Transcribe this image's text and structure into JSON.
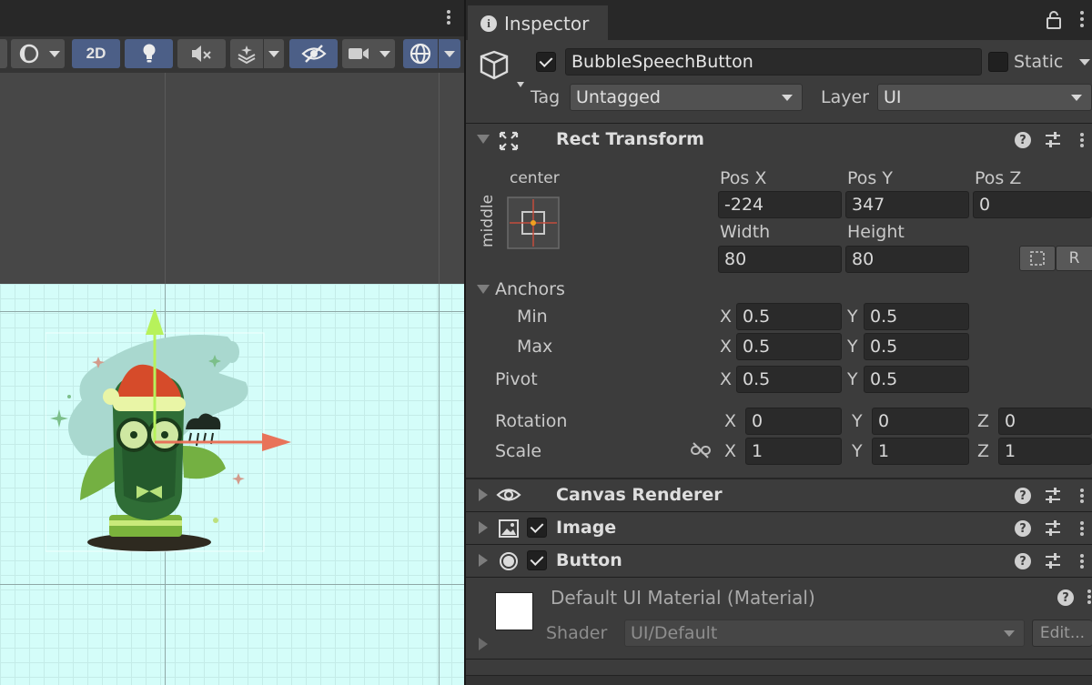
{
  "scene": {
    "toolbar": {
      "mode_2d_label": "2D"
    }
  },
  "inspector": {
    "tab_label": "Inspector",
    "gameobject": {
      "name": "BubbleSpeechButton",
      "active": true,
      "static_label": "Static",
      "tag_label": "Tag",
      "tag_value": "Untagged",
      "layer_label": "Layer",
      "layer_value": "UI"
    },
    "rect_transform": {
      "title": "Rect Transform",
      "anchor_preset_h": "center",
      "anchor_preset_v": "middle",
      "pos_x_label": "Pos X",
      "pos_y_label": "Pos Y",
      "pos_z_label": "Pos Z",
      "pos_x": "-224",
      "pos_y": "347",
      "pos_z": "0",
      "width_label": "Width",
      "height_label": "Height",
      "width": "80",
      "height": "80",
      "raw_edit_label": "R",
      "anchors_label": "Anchors",
      "min_label": "Min",
      "max_label": "Max",
      "pivot_label": "Pivot",
      "anchor_min_x": "0.5",
      "anchor_min_y": "0.5",
      "anchor_max_x": "0.5",
      "anchor_max_y": "0.5",
      "pivot_x": "0.5",
      "pivot_y": "0.5",
      "rotation_label": "Rotation",
      "scale_label": "Scale",
      "rotation_x": "0",
      "rotation_y": "0",
      "rotation_z": "0",
      "scale_x": "1",
      "scale_y": "1",
      "scale_z": "1",
      "axis_x": "X",
      "axis_y": "Y",
      "axis_z": "Z"
    },
    "components": {
      "canvas_renderer": "Canvas Renderer",
      "image": "Image",
      "image_enabled": true,
      "button": "Button",
      "button_enabled": true
    },
    "material": {
      "name": "Default UI Material (Material)",
      "shader_label": "Shader",
      "shader_value": "UI/Default",
      "edit_label": "Edit..."
    }
  },
  "colors": {
    "canvas_bg": "#d4fdf9",
    "toolbar_active": "#4c5f87",
    "gizmo_x": "#e8735a",
    "gizmo_y": "#b7f25b"
  }
}
